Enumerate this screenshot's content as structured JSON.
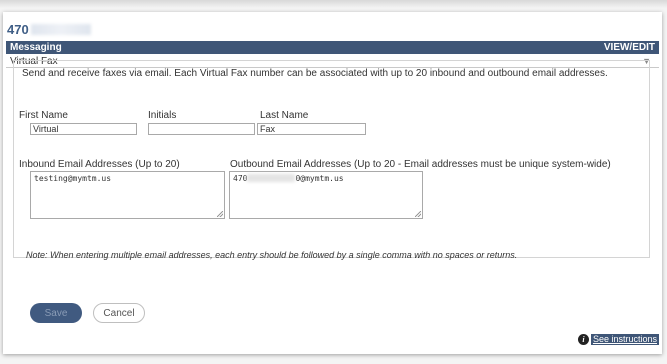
{
  "page": {
    "phone_number_prefix": "470"
  },
  "header": {
    "title": "Messaging",
    "action": "VIEW/EDIT"
  },
  "section": {
    "title": "Virtual Fax",
    "toggle_glyph": "▼"
  },
  "form": {
    "intro": "Send and receive faxes via email. Each Virtual Fax number can be associated with up to 20 inbound and outbound email addresses.",
    "first_name": {
      "label": "First Name",
      "value": "Virtual"
    },
    "initials": {
      "label": "Initials",
      "value": ""
    },
    "last_name": {
      "label": "Last Name",
      "value": "Fax"
    },
    "inbound": {
      "label": "Inbound Email Addresses (Up to 20)",
      "value": "testing@mymtm.us"
    },
    "outbound": {
      "label": "Outbound Email Addresses (Up to 20 - Email addresses must be unique system-wide)",
      "value_prefix": "470",
      "value_suffix": "0@mymtm.us"
    },
    "note": "Note:  When entering multiple email addresses, each entry should be followed by a single comma with no spaces or returns."
  },
  "buttons": {
    "save": "Save",
    "cancel": "Cancel"
  },
  "footer": {
    "instructions_link": "See instructions",
    "info_icon": "info-icon"
  },
  "colors": {
    "header_bg": "#3f5677",
    "phone_text": "#3f5e86",
    "save_bg": "#405a80"
  }
}
